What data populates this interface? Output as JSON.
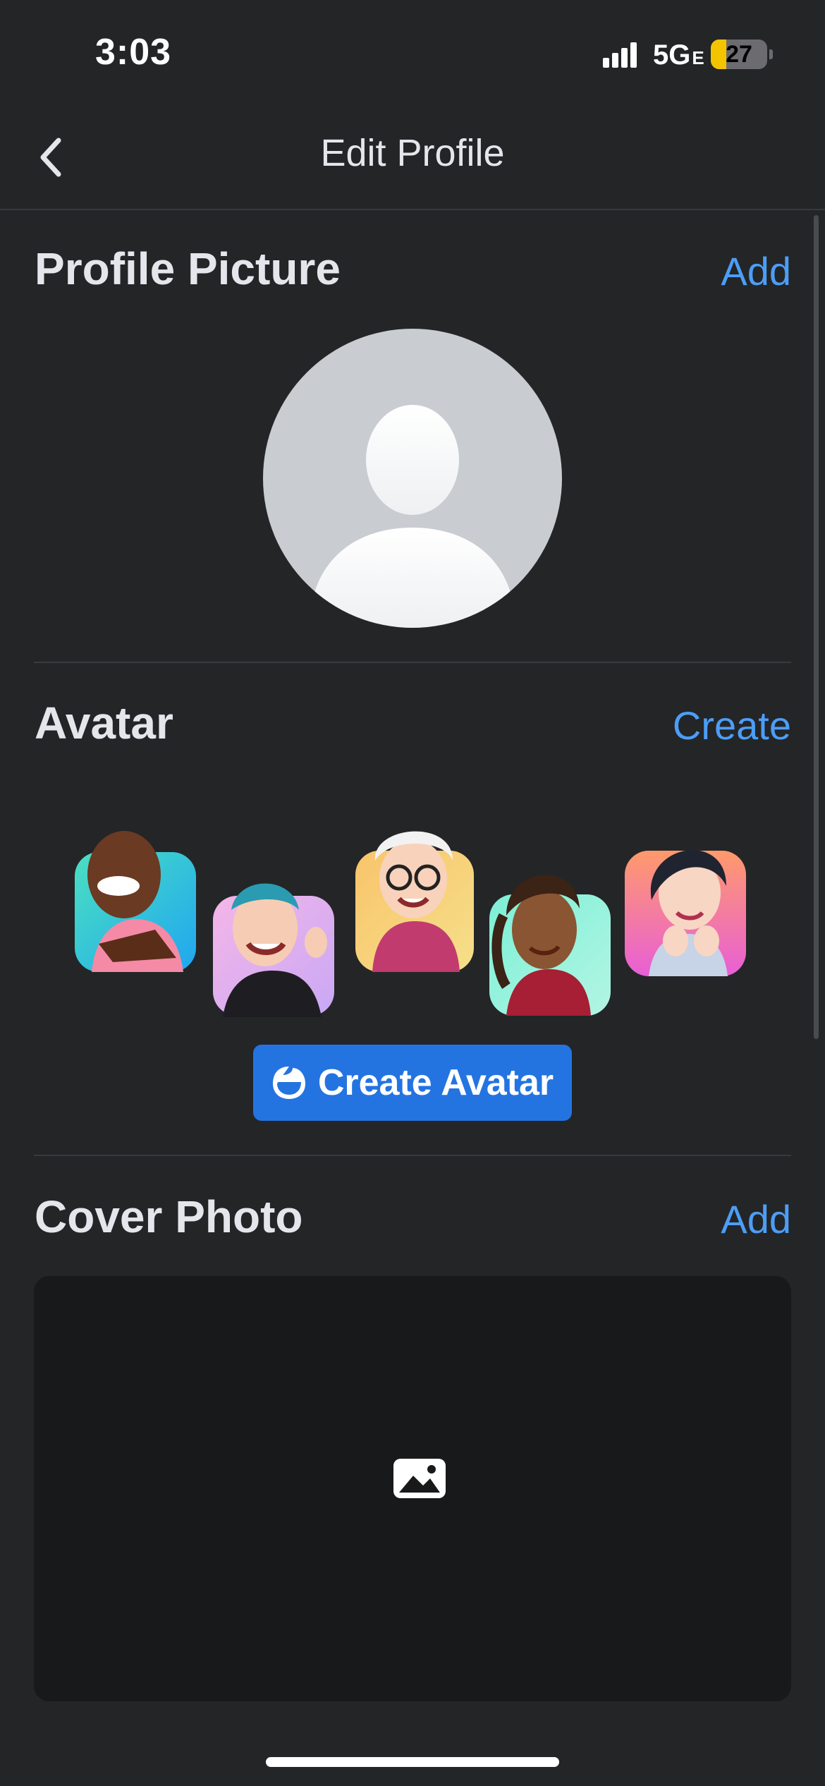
{
  "status_bar": {
    "time": "3:03",
    "network": "5G",
    "network_suffix": "E",
    "battery": "27",
    "battery_level_percent": 27
  },
  "nav": {
    "title": "Edit Profile",
    "back_icon": "chevron-left-icon"
  },
  "profile_picture": {
    "title": "Profile Picture",
    "action": "Add",
    "placeholder_icon": "default-avatar-silhouette"
  },
  "avatar": {
    "title": "Avatar",
    "action": "Create",
    "button_label": "Create Avatar",
    "button_icon": "avatar-face-icon",
    "examples": [
      {
        "name": "avatar-example-1",
        "bg": [
          "#4be0c1",
          "#1fa6f0"
        ]
      },
      {
        "name": "avatar-example-2",
        "bg": [
          "#f4b6e8",
          "#c9a8f5"
        ]
      },
      {
        "name": "avatar-example-3",
        "bg": [
          "#f9c46b",
          "#f5e08a"
        ]
      },
      {
        "name": "avatar-example-4",
        "bg": [
          "#7cf0d6",
          "#b3f5e4"
        ]
      },
      {
        "name": "avatar-example-5",
        "bg": [
          "#ff9a6b",
          "#e85fd6"
        ]
      }
    ]
  },
  "cover_photo": {
    "title": "Cover Photo",
    "action": "Add",
    "placeholder_icon": "image-icon"
  },
  "colors": {
    "background": "#242527",
    "accent": "#4c9ef6",
    "button": "#2374e1",
    "divider": "#393a3d",
    "cover_bg": "#18191a"
  }
}
